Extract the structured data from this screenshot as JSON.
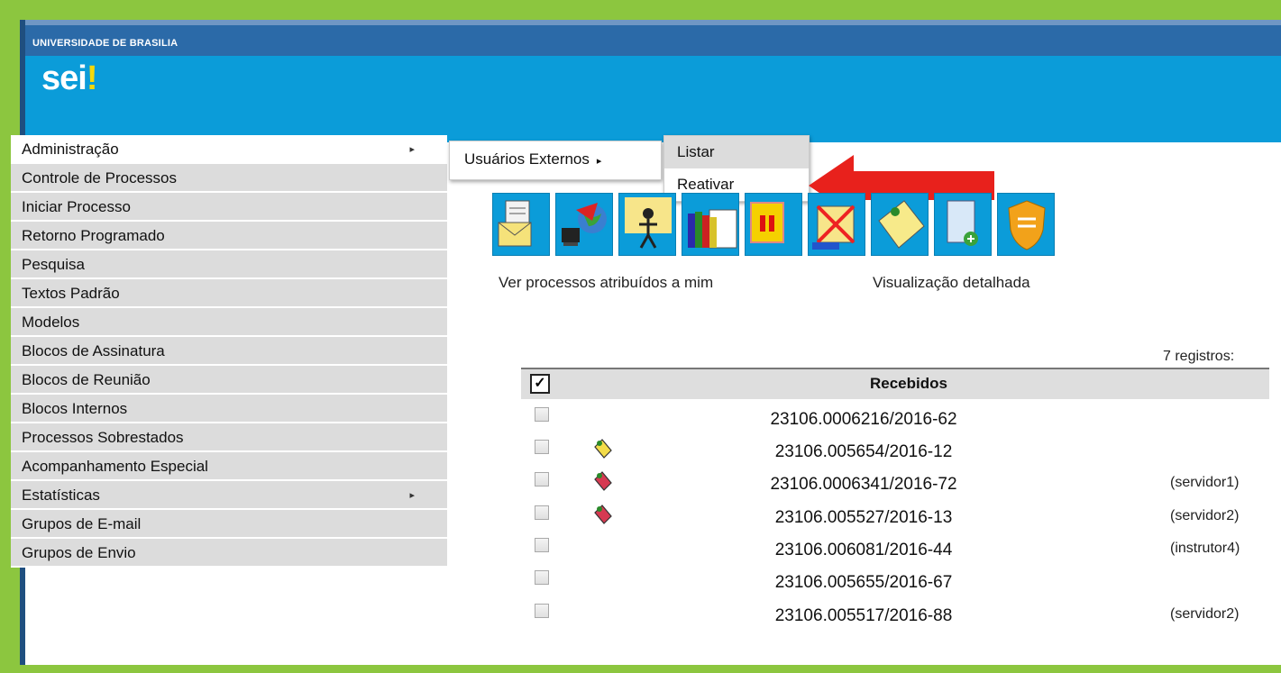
{
  "header": {
    "university": "UNIVERSIDADE DE BRASILIA",
    "logo_text": "sei",
    "logo_mark": "!"
  },
  "menu": {
    "items": [
      {
        "label": "Administração",
        "has_submenu": true,
        "active": true
      },
      {
        "label": "Controle de Processos"
      },
      {
        "label": "Iniciar Processo"
      },
      {
        "label": "Retorno Programado"
      },
      {
        "label": "Pesquisa"
      },
      {
        "label": "Textos Padrão"
      },
      {
        "label": "Modelos"
      },
      {
        "label": "Blocos de Assinatura"
      },
      {
        "label": "Blocos de Reunião"
      },
      {
        "label": "Blocos Internos"
      },
      {
        "label": "Processos Sobrestados"
      },
      {
        "label": "Acompanhamento Especial"
      },
      {
        "label": "Estatísticas",
        "has_submenu": true
      },
      {
        "label": "Grupos de E-mail"
      },
      {
        "label": "Grupos de Envio"
      }
    ],
    "arrow_glyph": "▸"
  },
  "submenu": {
    "level1_label": "Usuários Externos",
    "level2": [
      {
        "label": "Listar",
        "highlighted": true
      },
      {
        "label": "Reativar"
      }
    ]
  },
  "toolbar": {
    "icons": [
      "envelope-document-icon",
      "globe-network-icon",
      "person-assign-icon",
      "books-icon",
      "pause-icon",
      "cancel-document-icon",
      "notepad-icon",
      "new-document-icon",
      "shield-icon"
    ]
  },
  "links": {
    "assigned": "Ver processos atribuídos a mim",
    "detailed": "Visualização detalhada"
  },
  "table": {
    "record_count": "7 registros:",
    "header": "Recebidos",
    "header_checkbox": "✓",
    "rows": [
      {
        "number": "23106.0006216/2016-62",
        "user": "",
        "marker": ""
      },
      {
        "number": "23106.005654/2016-12",
        "user": "",
        "marker": "yellow"
      },
      {
        "number": "23106.0006341/2016-72",
        "user": "(servidor1)",
        "marker": "red"
      },
      {
        "number": "23106.005527/2016-13",
        "user": "(servidor2)",
        "marker": "red"
      },
      {
        "number": "23106.006081/2016-44",
        "user": "(instrutor4)",
        "marker": ""
      },
      {
        "number": "23106.005655/2016-67",
        "user": "",
        "marker": ""
      },
      {
        "number": "23106.005517/2016-88",
        "user": "(servidor2)",
        "marker": ""
      }
    ]
  },
  "colors": {
    "frame_green": "#8cc63f",
    "brand_blue": "#0b9cd9",
    "top_blue": "#2b6aa8",
    "annotation_red": "#e8211c"
  }
}
